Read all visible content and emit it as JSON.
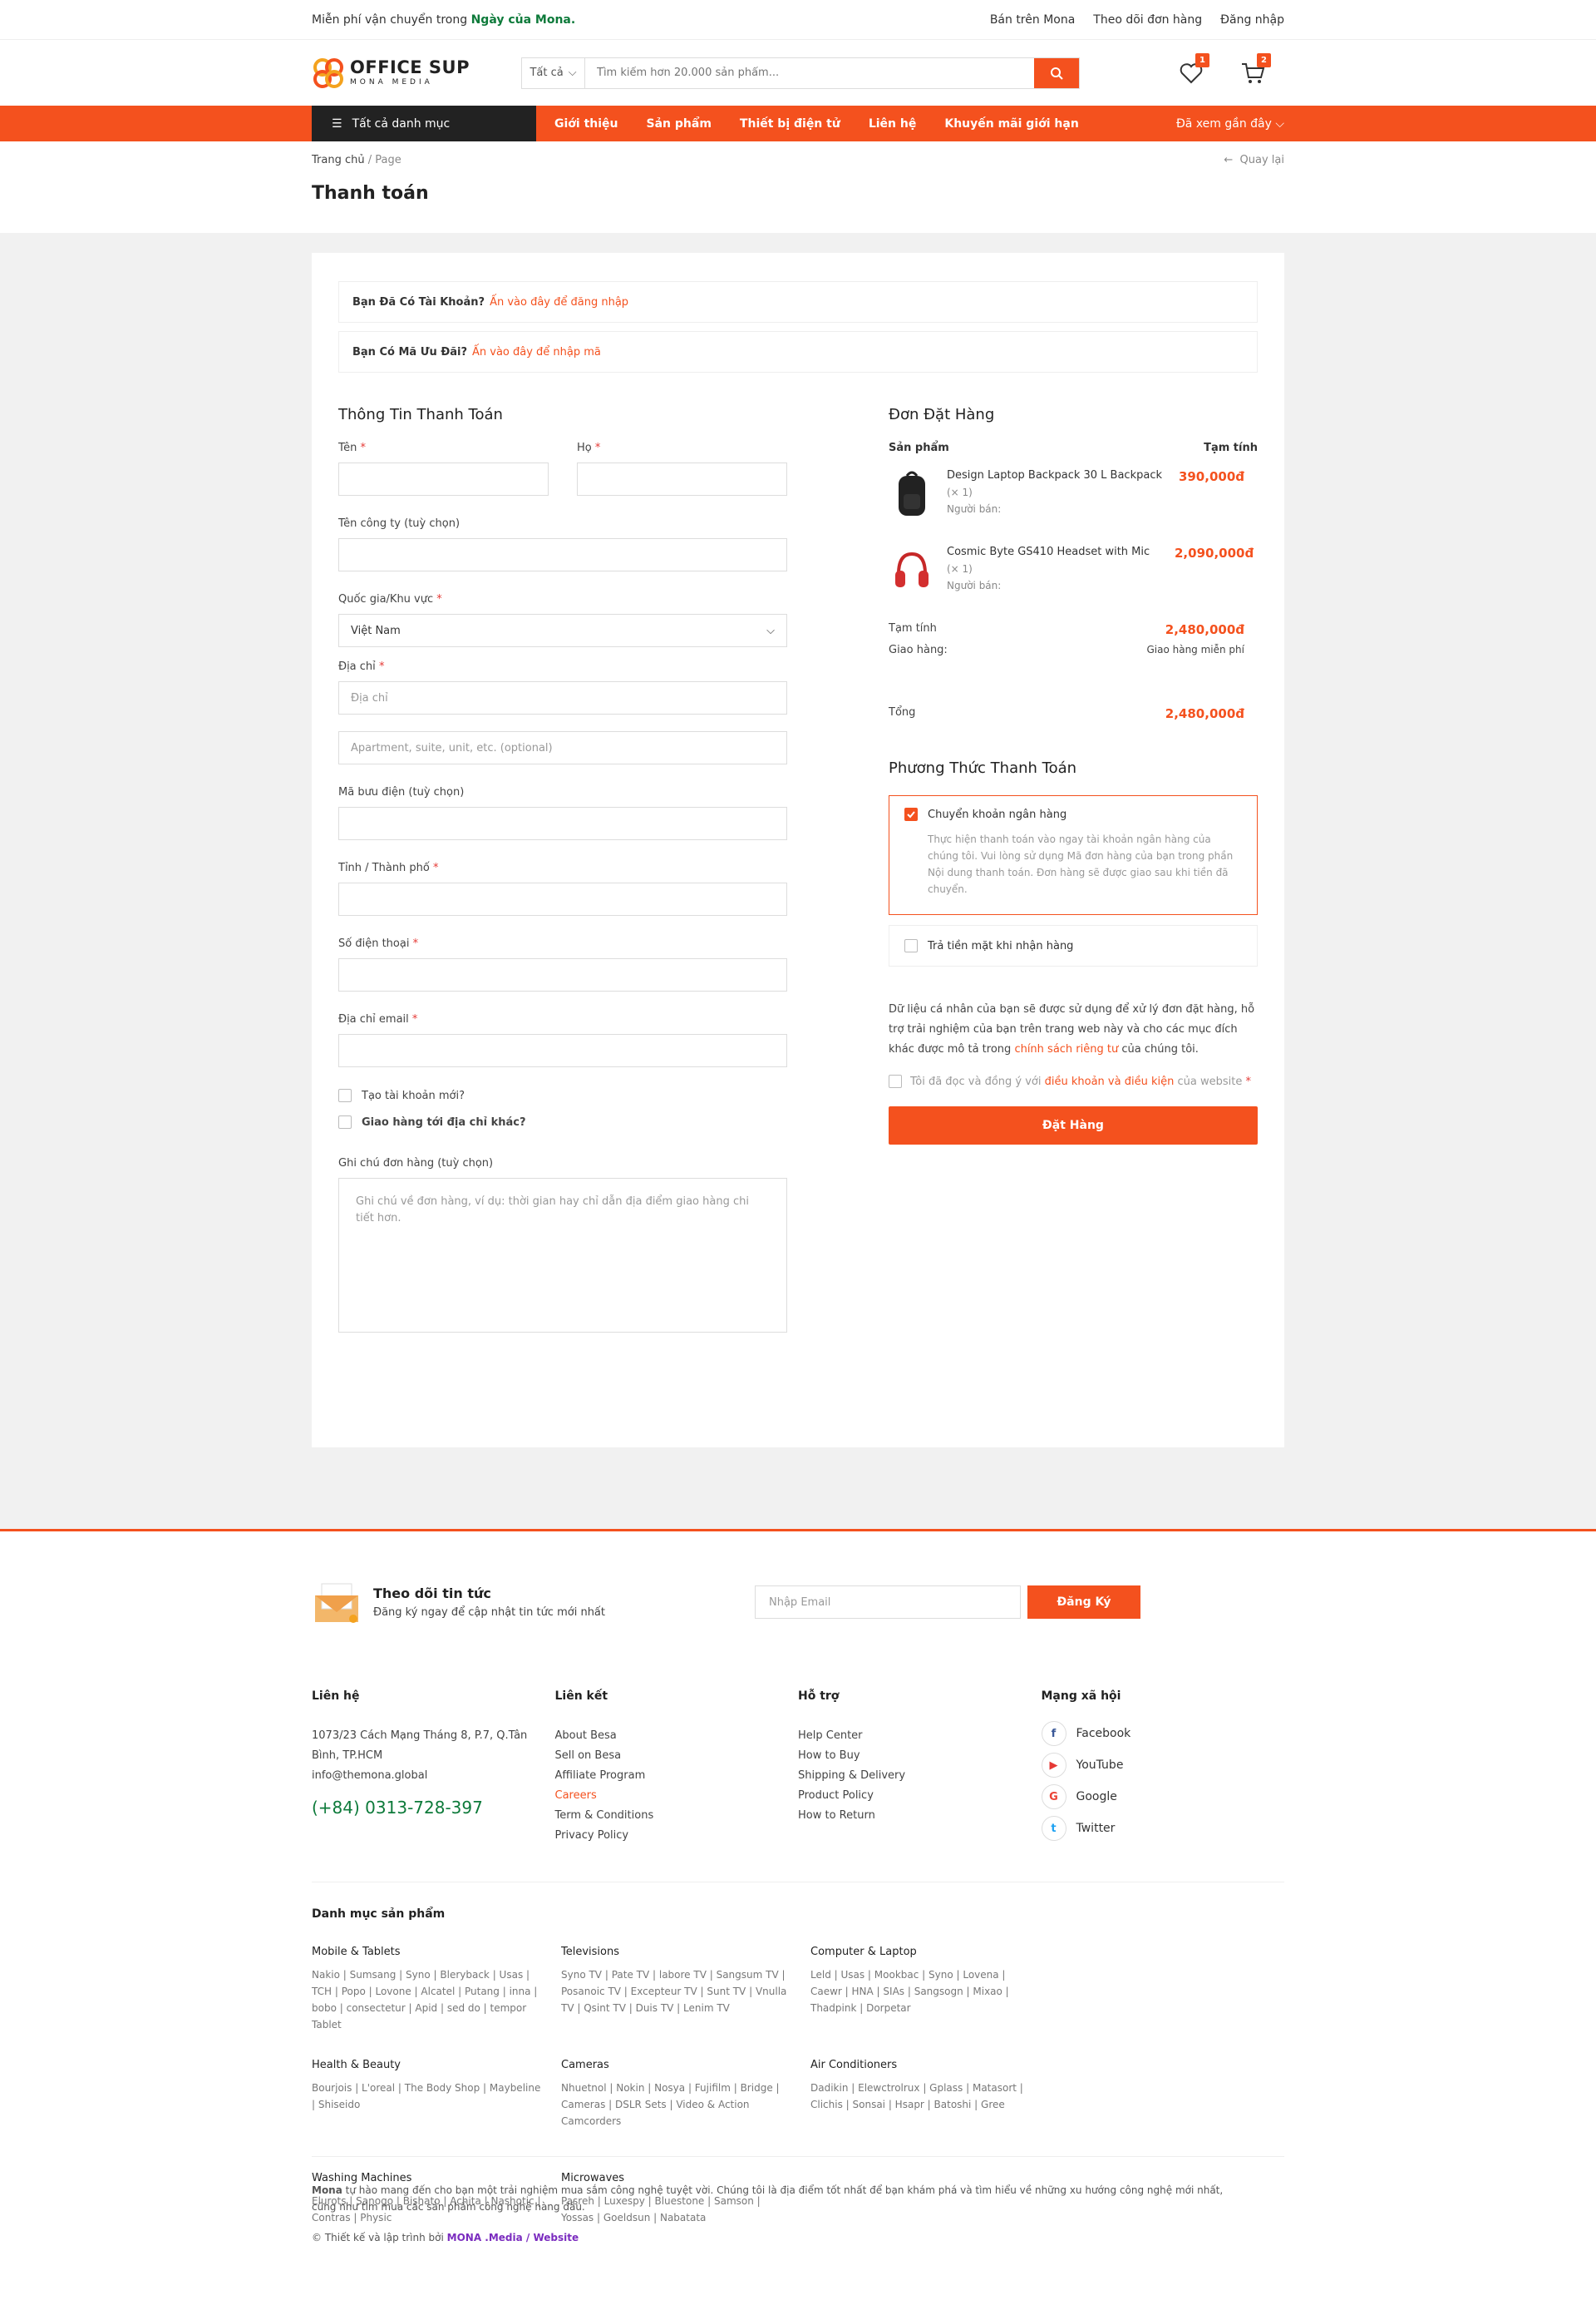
{
  "topbar": {
    "promo_prefix": "Miễn phí vận chuyển trong",
    "promo_highlight": "Ngày của Mona.",
    "links": [
      "Bán trên Mona",
      "Theo dõi đơn hàng",
      "Đăng nhập"
    ]
  },
  "brand": {
    "name": "OFFICE SUP",
    "sub": "MONA MEDIA",
    "accent": "#f4511e",
    "green": "#0d7a3a"
  },
  "search": {
    "category": "Tất cả",
    "placeholder": "Tìm kiếm hơn 20.000 sản phẩm..."
  },
  "header": {
    "wishlist_count": "1",
    "cart_count": "2"
  },
  "nav": {
    "all_categories": "Tất cả danh mục",
    "links": [
      "Giới thiệu",
      "Sản phẩm",
      "Thiết bị điện tử",
      "Liên hệ",
      "Khuyến mãi giới hạn"
    ],
    "recent": "Đã xem gần đây"
  },
  "breadcrumb": {
    "home": "Trang chủ",
    "sep": " / ",
    "current": "Page",
    "back": "Quay lại"
  },
  "page": {
    "title": "Thanh toán"
  },
  "notices": [
    {
      "label": "Bạn Đã Có Tài Khoản?",
      "link": "Ấn vào đây để đăng nhập"
    },
    {
      "label": "Bạn Có Mã Ưu Đãi?",
      "link": "Ấn vào đây để nhập mã"
    }
  ],
  "billing": {
    "title": "Thông Tin Thanh Toán",
    "first_name": "Tên",
    "last_name": "Họ",
    "company": "Tên công ty (tuỳ chọn)",
    "country": "Quốc gia/Khu vực",
    "country_value": "Việt Nam",
    "address": "Địa chỉ",
    "address_ph": "Địa chỉ",
    "address2_ph": "Apartment, suite, unit, etc. (optional)",
    "postcode": "Mã bưu điện (tuỳ chọn)",
    "city": "Tỉnh / Thành phố",
    "phone": "Số điện thoại",
    "email": "Địa chỉ email",
    "create_account": "Tạo tài khoản mới?",
    "ship_other": "Giao hàng tới địa chỉ khác?",
    "notes": "Ghi chú đơn hàng (tuỳ chọn)",
    "notes_ph": "Ghi chú về đơn hàng, ví dụ: thời gian hay chỉ dẫn địa điểm giao hàng chi tiết hơn.",
    "req": "*"
  },
  "order": {
    "title": "Đơn Đặt Hàng",
    "col_product": "Sản phẩm",
    "col_subtotal": "Tạm tính",
    "items": [
      {
        "name": "Design Laptop Backpack 30 L Backpack",
        "qty": "(× 1)",
        "seller": "Người bán:",
        "price": "390,000đ"
      },
      {
        "name": "Cosmic Byte GS410 Headset with Mic",
        "qty": "(× 1)",
        "seller": "Người bán:",
        "price": "2,090,000đ"
      }
    ],
    "subtotal_label": "Tạm tính",
    "subtotal": "2,480,000đ",
    "shipping_label": "Giao hàng:",
    "shipping": "Giao hàng miễn phí",
    "total_label": "Tổng",
    "total": "2,480,000đ"
  },
  "payment": {
    "title": "Phương Thức Thanh Toán",
    "bank": "Chuyển khoản ngân hàng",
    "bank_desc": "Thực hiện thanh toán vào ngay tài khoản ngân hàng của chúng tôi. Vui lòng sử dụng Mã đơn hàng của bạn trong phần Nội dung thanh toán. Đơn hàng sẽ được giao sau khi tiền đã chuyển.",
    "cod": "Trả tiền mặt khi nhận hàng",
    "privacy_1": "Dữ liệu cá nhân của bạn sẽ được sử dụng để xử lý đơn đặt hàng, hỗ trợ trải nghiệm của bạn trên trang web này và cho các mục đích khác được mô tả trong",
    "privacy_link": "chính sách riêng tư",
    "privacy_2": "của chúng tôi.",
    "agree_1": "Tôi đã đọc và đồng ý với",
    "agree_link": "điều khoản và điều kiện",
    "agree_2": "của website",
    "place": "Đặt Hàng"
  },
  "newsletter": {
    "title": "Theo dõi tin tức",
    "sub": "Đăng ký ngay để cập nhật tin tức mới nhất",
    "placeholder": "Nhập Email",
    "button": "Đăng Ký"
  },
  "footer": {
    "contact_title": "Liên hệ",
    "address": "1073/23 Cách Mạng Tháng 8, P.7, Q.Tân Bình, TP.HCM",
    "email": "info@themona.global",
    "phone": "(+84) 0313-728-397",
    "links_title": "Liên kết",
    "links": [
      "About Besa",
      "Sell on Besa",
      "Affiliate Program",
      "Careers",
      "Term & Conditions",
      "Privacy Policy"
    ],
    "support_title": "Hỗ trợ",
    "support": [
      "Help Center",
      "How to Buy",
      "Shipping & Delivery",
      "Product Policy",
      "How to Return"
    ],
    "social_title": "Mạng xã hội",
    "social": [
      "Facebook",
      "YouTube",
      "Google",
      "Twitter"
    ],
    "cat_title": "Danh mục sản phẩm",
    "cats": [
      {
        "name": "Mobile & Tablets",
        "list": "Nakio | Sumsang | Syno | Bleryback | Usas | TCH | Popo | Lovone | Alcatel | Putang | inna | bobo | consectetur | Apid | sed do | tempor Tablet"
      },
      {
        "name": "Televisions",
        "list": "Syno TV | Pate TV | labore TV | Sangsum TV | Posanoic TV | Excepteur TV | Sunt TV | Vnulla TV | Qsint TV | Duis TV | Lenim TV"
      },
      {
        "name": "Computer & Laptop",
        "list": "Leld | Usas | Mookbac | Syno | Lovena | Caewr | HNA | SIAs | Sangsogn | Mixao | Thadpink | Dorpetar"
      },
      {
        "name": "Health & Beauty",
        "list": "Bourjois | L'oreal | The Body Shop | Maybeline | Shiseido"
      },
      {
        "name": "Cameras",
        "list": "Nhuetnol | Nokin | Nosya | Fujifilm | Bridge | Cameras | DSLR Sets | Video & Action Camcorders"
      },
      {
        "name": "Air Conditioners",
        "list": "Dadikin | Elewctrolrux | Gplass | Matasort | Clichis | Sonsai | Hsapr | Batoshi | Gree"
      },
      {
        "name": "Washing Machines",
        "list": "Elurots | Sanogo | Bishato | Achita | Nashotic | Contras | Physic"
      },
      {
        "name": "Microwaves",
        "list": "Pasreh | Luxespy | Bluestone | Samson | Yossas | Goeldsun | Nabatata"
      }
    ],
    "about_brand": "Mona",
    "about": "tự hào mang đến cho bạn một trải nghiệm mua sắm công nghệ tuyệt vời. Chúng tôi là địa điểm tốt nhất để bạn khám phá và tìm hiểu về những xu hướng công nghệ mới nhất, cũng như tìm mua các sản phẩm công nghệ hàng đầu.",
    "copyright": "© Thiết kế và lập trình bởi",
    "mona": "MONA .Media / Website"
  }
}
